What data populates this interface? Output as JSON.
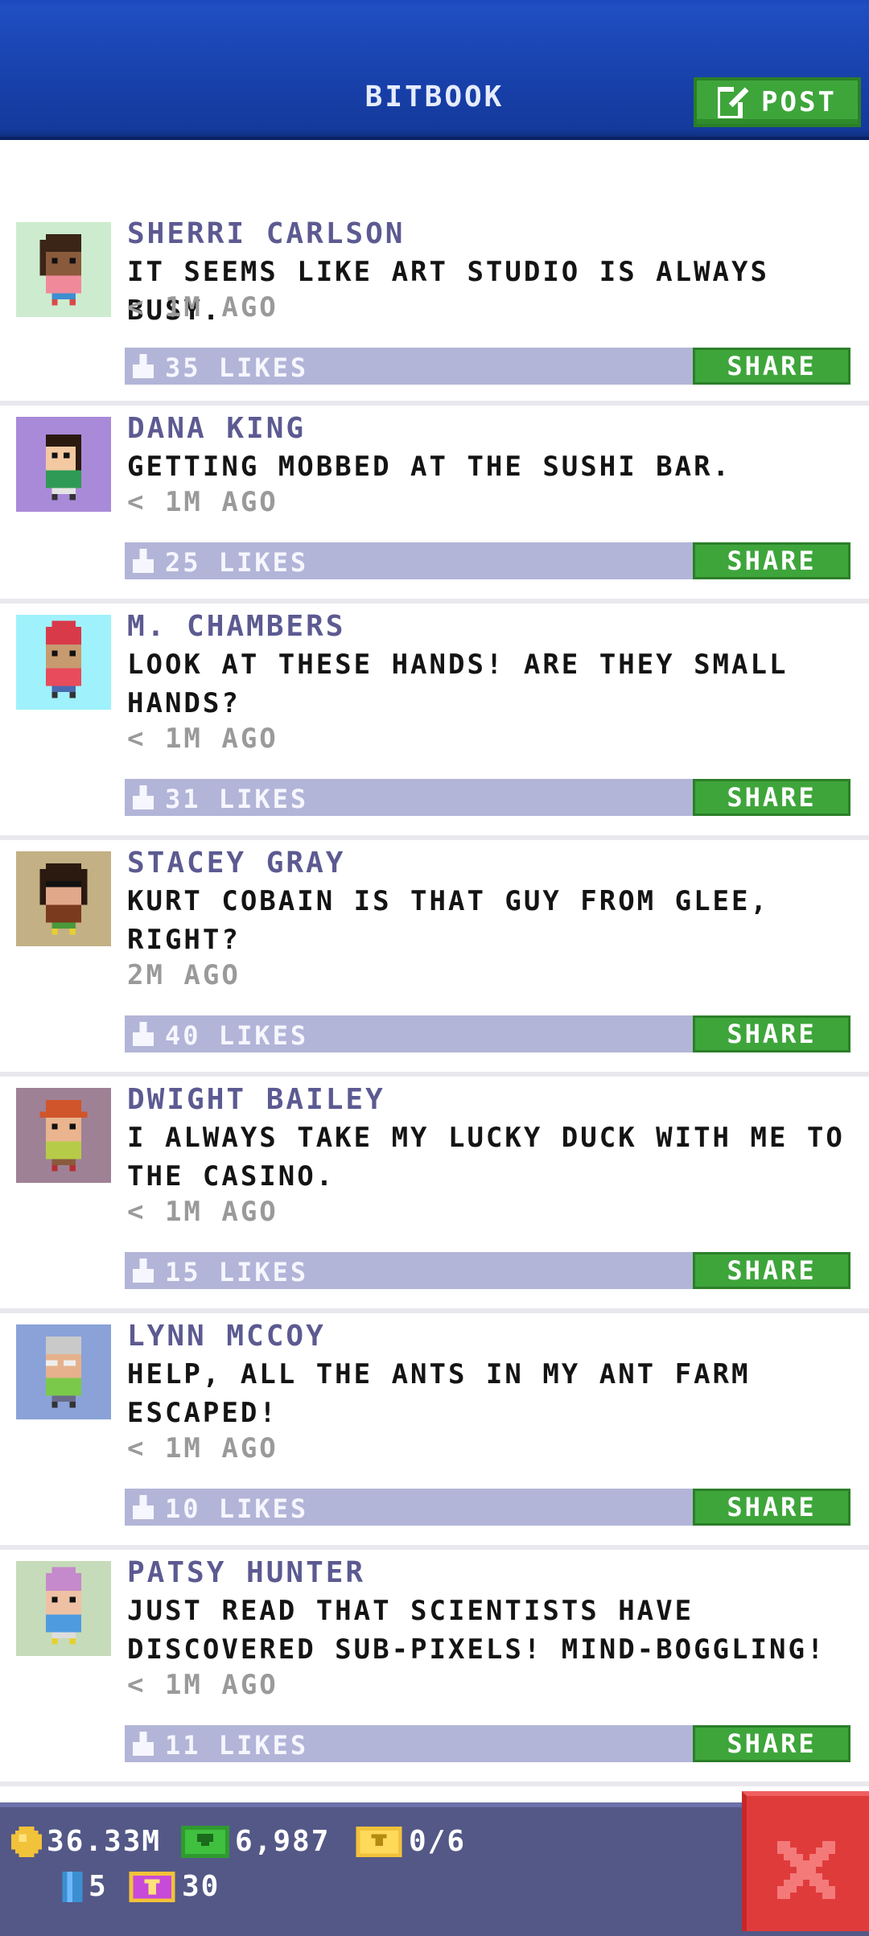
{
  "header": {
    "title": "BITBOOK",
    "post_label": "POST"
  },
  "posts": [
    {
      "name": "SHERRI CARLSON",
      "message": "IT SEEMS LIKE ART STUDIO IS ALWAYS BUSY.",
      "time": "< 1M AGO",
      "likes": "35 LIKES",
      "share": "SHARE"
    },
    {
      "name": "DANA KING",
      "message": "GETTING MOBBED AT THE SUSHI BAR.",
      "time": "< 1M AGO",
      "likes": "25 LIKES",
      "share": "SHARE"
    },
    {
      "name": "M. CHAMBERS",
      "message": "LOOK AT THESE HANDS! ARE THEY SMALL HANDS?",
      "time": "< 1M AGO",
      "likes": "31 LIKES",
      "share": "SHARE"
    },
    {
      "name": "STACEY GRAY",
      "message": "KURT COBAIN IS THAT GUY FROM GLEE, RIGHT?",
      "time": "2M AGO",
      "likes": "40 LIKES",
      "share": "SHARE"
    },
    {
      "name": "DWIGHT BAILEY",
      "message": "I ALWAYS TAKE MY LUCKY DUCK WITH ME TO THE CASINO.",
      "time": "< 1M AGO",
      "likes": "15 LIKES",
      "share": "SHARE"
    },
    {
      "name": "LYNN MCCOY",
      "message": "HELP, ALL THE ANTS IN MY ANT FARM ESCAPED!",
      "time": "< 1M AGO",
      "likes": "10 LIKES",
      "share": "SHARE"
    },
    {
      "name": "PATSY HUNTER",
      "message": "JUST READ THAT SCIENTISTS HAVE DISCOVERED SUB-PIXELS! MIND-BOGGLING!",
      "time": "< 1M AGO",
      "likes": "11 LIKES",
      "share": "SHARE"
    }
  ],
  "status": {
    "coins": "36.33M",
    "bux": "6,987",
    "tickets": "0/6",
    "elevator": "5",
    "vip": "30"
  },
  "colors": {
    "header_blue": "#173fa8",
    "green_button": "#3ea53b",
    "likes_bar": "#b2b5d7",
    "name_purple": "#5c5a91",
    "status_bar": "#545887",
    "close_red": "#e03b3b"
  },
  "icons": {
    "post": "edit-icon",
    "likes": "thumbs-up-icon",
    "coins": "coin-icon",
    "bux": "bux-icon",
    "tickets": "ticket-icon",
    "elevator": "elevator-icon",
    "vip": "vip-icon",
    "close": "close-icon"
  }
}
